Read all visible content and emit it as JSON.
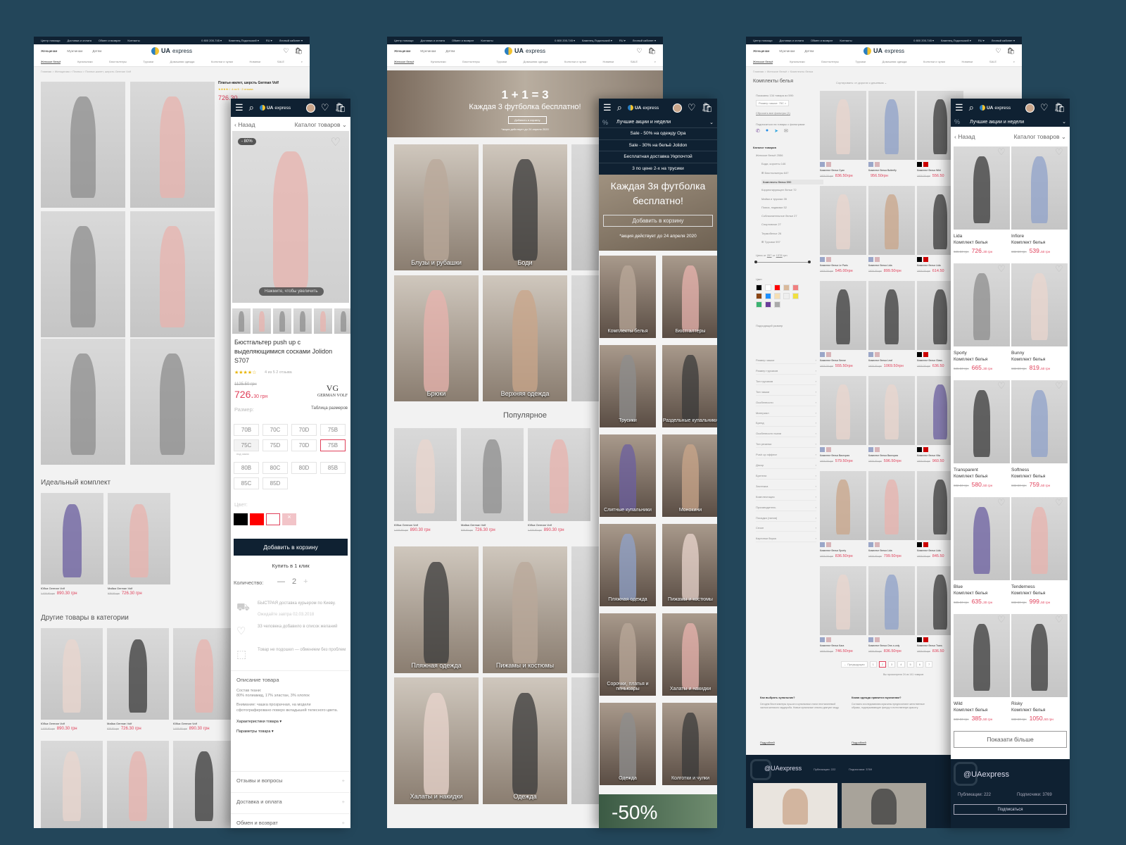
{
  "colors": {
    "background": "#23465a",
    "header": "#0f2132",
    "accent_price": "#e0405a"
  },
  "desktop_header": {
    "topbar": [
      "Центр помощи",
      "Доставка и оплата",
      "Обмен и возврат",
      "Контакты"
    ],
    "phone": "0 800 200-745 ▾",
    "city": "Каменец-Подольский ▾",
    "lang": "RU ▾",
    "account": "Личный кабинет ▾",
    "audience": [
      "Женщинам",
      "Мужчинам",
      "Детям"
    ],
    "logo_bold": "UA",
    "logo_rest": "express",
    "categories": [
      "Женское бельё",
      "Купальники",
      "Бюстгалтеры",
      "Трусики",
      "Домашняя одежда",
      "Колготки и чулки",
      "Новинки",
      "SALE"
    ]
  },
  "desktop_product": {
    "breadcrumb": "Главная  >  Женщинам  >  Платья  >  Платье-жилет, шерсть German Volf",
    "title": "Платье-жилет, шерсть German Volf",
    "rating_text": "★★★★☆ 4 из 5 · 2 отзыва",
    "price": "726.30",
    "perfect_set_title": "Идеальный комплект",
    "perfect_set": [
      {
        "name": "Юбка German Volf",
        "old": "1 020.50 грн",
        "price": "890.30 грн"
      },
      {
        "name": "Майка German Volf",
        "old": "925.50 грн",
        "price": "726.30 грн"
      }
    ],
    "other_title": "Другие товары в категории",
    "other": [
      {
        "name": "Юбка German Volf",
        "old": "1 020.50 грн",
        "price": "890.30 грн"
      },
      {
        "name": "Майка German Volf",
        "old": "925.50 грн",
        "price": "726.30 грн"
      },
      {
        "name": "Юбка German Volf",
        "old": "1 020.50 грн",
        "price": "890.30 грн"
      }
    ]
  },
  "mobile_product": {
    "back": "‹ Назад",
    "catalog": "Каталог товаров ⌄",
    "discount_badge": "- 80%",
    "zoom_hint": "Нажмите, чтобы увеличить",
    "title": "Бюстгальтер push up с выделяющимися сосками Jolidon S707",
    "stars": "★★★★☆",
    "rating": "4 из 5   2 отзыва",
    "old_price": "1125.50 грн",
    "price_main": "726.",
    "price_cents": "30 грн",
    "brand": "GERMAN VOLF",
    "size_label": "Размер:",
    "size_table": "Таблица размеров",
    "sizes": [
      "70B",
      "70C",
      "70D",
      "75B",
      "75C",
      "75D",
      "70D",
      "75B",
      "80B",
      "80C",
      "80D",
      "85B",
      "85C",
      "85D"
    ],
    "preorder": "под заказ",
    "color_label": "Цвет:",
    "swatches": [
      "#000000",
      "#ff0000",
      "#ffffff",
      "#f2c4c8"
    ],
    "add_to_cart": "Добавить в корзину",
    "buy_one_click": "Купить в 1 клик",
    "qty_label": "Количество:",
    "qty": "2",
    "info": [
      {
        "icon": "truck-icon",
        "text": "БЫСТРАЯ доставка курьером по Киеву.",
        "sub": "Ожидайте завтра 02.03.2018"
      },
      {
        "icon": "heart-icon",
        "text": "33 человека добавило в список желаний",
        "sub": ""
      },
      {
        "icon": "box-icon",
        "text": "Товар не подошел — обменяем без проблем",
        "sub": ""
      }
    ],
    "desc_title": "Описание товара",
    "composition_label": "Состав ткани:",
    "composition": "80% полиамид, 17% эластан, 3% хлопок",
    "warning": "Внимание: чашка прозрачная, на модели сфотографировано поверх вкладышей телесного цвета.",
    "specs": "Характеристики товара ▾",
    "params": "Параметры товара ▾",
    "accordions": [
      "Отзывы и вопросы",
      "Доставка и оплата",
      "Обмен и возврат"
    ]
  },
  "desktop_home": {
    "hero_title": "1 + 1 = 3",
    "hero_sub": "Каждая 3 футболка бесплатно!",
    "hero_btn": "Добавить в корзину",
    "hero_note": "*акция действует до 24 апреля 2020",
    "categories_top": [
      "Блузы и рубашки",
      "Боди",
      "Брюки",
      "Верхняя одежда"
    ],
    "popular_title": "Популярное",
    "popular": [
      {
        "name": "Юбка German Volf",
        "old": "1 020.50 грн",
        "price": "890.30 грн"
      },
      {
        "name": "Майка German Volf",
        "old": "925.50 грн",
        "price": "726.30 грн"
      },
      {
        "name": "Юбка German Volf",
        "old": "1 020.50 грн",
        "price": "890.30 грн"
      }
    ],
    "categories_bottom": [
      "Пляжная одежда",
      "Пижамы и костюмы",
      "Халаты и накидки",
      "Одежда"
    ]
  },
  "mobile_home": {
    "promo_title": "Лучшие акции и недели",
    "promos": [
      "Sale - 50% на одежду Opa",
      "Sale - 30% на бельё Jolidon",
      "Бесплатная доставка Укрпочтой",
      "3 по цене 2-х на трусики"
    ],
    "hero_title": "Каждая 3я футболка бесплатно!",
    "hero_btn": "Добавить в корзину",
    "hero_note": "*акция действует до 24 апреля 2020",
    "tiles": [
      "Комплекты белья",
      "Бюстгалтеры",
      "Трусики",
      "Раздельные купальники",
      "Слитные купальники",
      "Монокини",
      "Пляжная одежда",
      "Пижамы и костюмы",
      "Сорочки, платья и пеньюары",
      "Халаты и накидки",
      "Одежда",
      "Колготки и чулки"
    ],
    "sale_banner": "-50%"
  },
  "desktop_catalog": {
    "breadcrumb": "Главная  >  Женское бельё  >  Комплекты белья",
    "title": "Комплекты белья",
    "sort": "Сортировать: от дорогих к дешевым ⌄",
    "shown": "Показаны 134 товара из 590:",
    "filter_chip": "Размер чашки: 75C ×",
    "reset": "Сбросить все фильтры (1)",
    "subscribe": "Подписаться на товары с фильтрами:",
    "catalog_title": "Каталог товаров",
    "tree": [
      "Женское бельё 2556",
      "Боди, корсеты 146",
      "⊞ Бюстгальтеры 647",
      "Комплекты белья 590",
      "Корректирующее белье 72",
      "Майки и трусики 35",
      "Пояса, подвязки 52",
      "Соблазнительное белье 27",
      "Спортивное 27",
      "Термобелье 26",
      "⊞ Трусики 997"
    ],
    "price_label": "Цена",
    "price_from": "257",
    "price_to": "1378",
    "currency": "грн",
    "filters": [
      "Цвет",
      "Подходящий размер",
      "Размер чашки",
      "Размер трусиков",
      "Тип трусиков",
      "Тип чашки",
      "Особенности",
      "Материал",
      "Бренд",
      "Особенности ткани",
      "Тип резинки",
      "Push up эффект",
      "Декор",
      "Бретели",
      "Застежка",
      "Комплектация",
      "Производитель",
      "Посадка (талия)",
      "Сезон",
      "Картинки бирка"
    ],
    "products": [
      {
        "name": "Комплект белья Cyan",
        "old": "1920.30 грн",
        "price": "836.50грн"
      },
      {
        "name": "Комплект белья Butterfly",
        "old": "",
        "price": "956.50грн"
      },
      {
        "name": "Комплект белья Wild",
        "old": "1920.30 грн",
        "price": "556.50"
      },
      {
        "name": "Комплект белья Le Paris",
        "old": "1920.30 грн",
        "price": "545.00грн"
      },
      {
        "name": "Комплект белья Lida",
        "old": "1920.30 грн",
        "price": "899.50грн"
      },
      {
        "name": "Комплект белья Lida",
        "old": "1920.30 грн",
        "price": "614.50"
      },
      {
        "name": "Комплект белья Sense",
        "old": "1920.30 грн",
        "price": "555.50грн"
      },
      {
        "name": "Комплект белья Leaf",
        "old": "1920.30 грн",
        "price": "1069.50грн"
      },
      {
        "name": "Комплект белья Glass",
        "old": "1920.30 грн",
        "price": "636.50"
      },
      {
        "name": "Комплект белья Виктория",
        "old": "1920.30 грн",
        "price": "579.50грн"
      },
      {
        "name": "Комплект белья Виктория",
        "old": "1920.30 грн",
        "price": "596.50грн"
      },
      {
        "name": "Комплект белья Vita",
        "old": "1920.30 грн",
        "price": "960.50"
      },
      {
        "name": "Комплект белья Sporty",
        "old": "1920.30 грн",
        "price": "836.50грн"
      },
      {
        "name": "Комплект белья Lida",
        "old": "1920.30 грн",
        "price": "799.50грн"
      },
      {
        "name": "Комплект белья Lida",
        "old": "1920.30 грн",
        "price": "845.50"
      },
      {
        "name": "Комплект белья Kara",
        "old": "1920.30 грн",
        "price": "746.50грн"
      },
      {
        "name": "Комплект белья One-n-only",
        "old": "1920.30 грн",
        "price": "836.50грн"
      },
      {
        "name": "Комплект белья Trans",
        "old": "1920.30 грн",
        "price": "836.50"
      }
    ],
    "pagination": [
      "← Предыдущая",
      "1",
      "2",
      "3",
      "4",
      "5",
      "6",
      "7"
    ],
    "pag_note": "Вы просмотрели 24 из 141 товаров",
    "seo": [
      {
        "title": "Как выбрать купальник?",
        "text": "Сегодня бюстгальтеры пуш-ап и купальники стали неотъемлемой частью женского гардероба. Новые купальные сезоны диктуют моду.",
        "more": "Подробней"
      },
      {
        "title": "Какая одежда нравится мужчинам?",
        "text": "Согласно исследованиям мужчины предпочитают женственные образы, подчеркивающие фигуру и естественную красоту.",
        "more": "Подробней"
      }
    ],
    "insta": "@UAexpress",
    "insta_posts": "Публикации: 222",
    "insta_followers": "Подписчики: 3769"
  },
  "mobile_catalog": {
    "promo_title": "Лучшие акции и недели",
    "back": "‹ Назад",
    "catalog": "Каталог товаров ⌄",
    "products": [
      {
        "model": "Lida",
        "type": "Комплект белья",
        "old": "925.50 грн",
        "price": "726.",
        "cents": "30 грн"
      },
      {
        "model": "Infiore",
        "type": "Комплект белья",
        "old": "682.50 грн",
        "price": "539.",
        "cents": "50 грн"
      },
      {
        "model": "Sporty",
        "type": "Комплект белья",
        "old": "925.50 грн",
        "price": "665.",
        "cents": "30 грн"
      },
      {
        "model": "Bunny",
        "type": "Комплект белья",
        "old": "682.50 грн",
        "price": "819.",
        "cents": "50 грн"
      },
      {
        "model": "Transparent",
        "type": "Комплект белья",
        "old": "682.50 грн",
        "price": "580.",
        "cents": "50 грн"
      },
      {
        "model": "Softness",
        "type": "Комплект белья",
        "old": "682.50 грн",
        "price": "759.",
        "cents": "50 грн"
      },
      {
        "model": "Blue",
        "type": "Комплект белья",
        "old": "925.50 грн",
        "price": "635.",
        "cents": "30 грн"
      },
      {
        "model": "Tenderness",
        "type": "Комплект белья",
        "old": "682.50 грн",
        "price": "999.",
        "cents": "50 грн"
      },
      {
        "model": "Wild",
        "type": "Комплект белья",
        "old": "682.50 грн",
        "price": "385.",
        "cents": "50 грн"
      },
      {
        "model": "Risky",
        "type": "Комплект белья",
        "old": "682.50 грн",
        "price": "1050.",
        "cents": "50 грн"
      }
    ],
    "show_more": "Показати більше",
    "insta": "@UAexpress",
    "insta_posts": "Публикации: 222",
    "insta_followers": "Подписчики: 3769",
    "subscribe": "Подписаться"
  }
}
